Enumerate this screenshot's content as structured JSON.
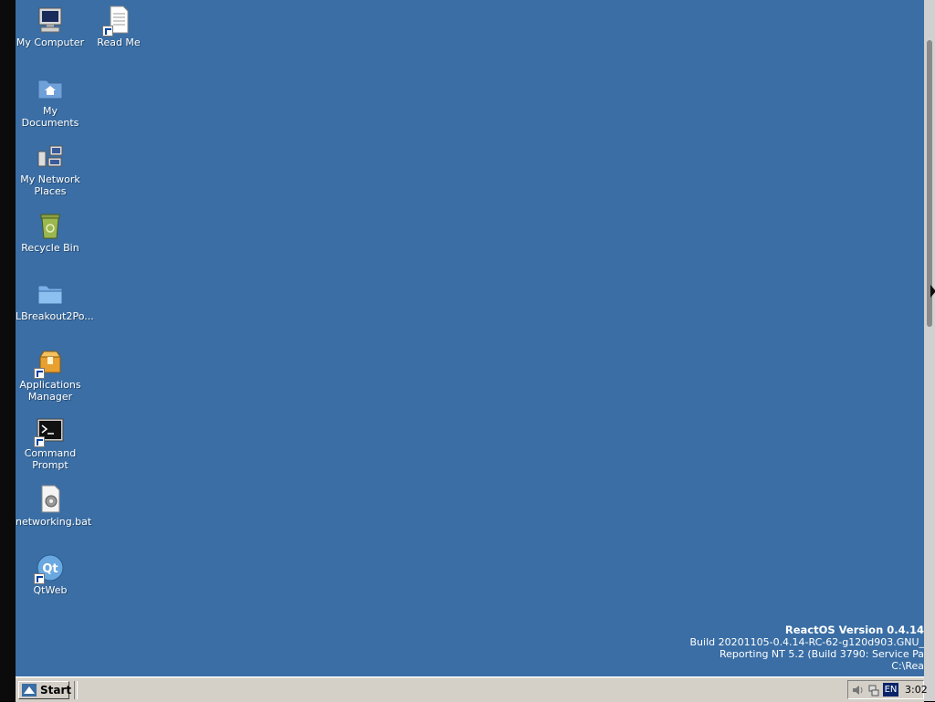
{
  "desktop": {
    "background_color": "#3a6ea5",
    "icons": [
      {
        "label": "My Computer",
        "icon": "my-computer-icon"
      },
      {
        "label": "Read Me",
        "icon": "document-icon"
      },
      {
        "label": "My Documents",
        "icon": "my-documents-folder-icon"
      },
      {
        "label": "My Network Places",
        "icon": "network-places-icon"
      },
      {
        "label": "Recycle Bin",
        "icon": "recycle-bin-icon"
      },
      {
        "label": "LBreakout2Po...",
        "icon": "folder-icon"
      },
      {
        "label": "Applications Manager",
        "icon": "applications-manager-icon"
      },
      {
        "label": "Command Prompt",
        "icon": "command-prompt-icon"
      },
      {
        "label": "networking.bat",
        "icon": "batch-file-icon"
      },
      {
        "label": "QtWeb",
        "icon": "qtweb-icon"
      }
    ]
  },
  "version_info": {
    "title": "ReactOS Version 0.4.14",
    "build": "Build 20201105-0.4.14-RC-62-g120d903.GNU_",
    "reporting": "Reporting NT 5.2 (Build 3790: Service Pa",
    "path": "C:\\Rea"
  },
  "taskbar": {
    "start_label": "Start",
    "language": "EN",
    "clock": "3:02",
    "tray_icons": [
      "speaker-icon",
      "network-icon"
    ]
  }
}
